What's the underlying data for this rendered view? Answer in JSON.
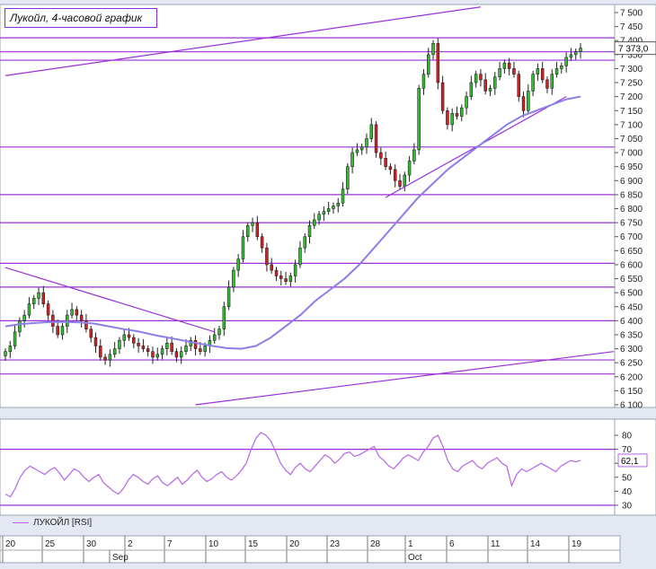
{
  "chart_data": [
    {
      "type": "candlestick",
      "title": "Лукойл, 4-часовой график",
      "y_axis": {
        "min": 6100,
        "max": 7500,
        "step": 50,
        "ticks": [
          "6 100",
          "6 150",
          "6 200",
          "6 250",
          "6 300",
          "6 350",
          "6 400",
          "6 450",
          "6 500",
          "6 550",
          "6 600",
          "6 650",
          "6 700",
          "6 750",
          "6 800",
          "6 850",
          "6 900",
          "6 950",
          "7 000",
          "7 050",
          "7 100",
          "7 150",
          "7 200",
          "7 250",
          "7 300",
          "7 350",
          "7 400",
          "7 450",
          "7 500"
        ]
      },
      "last_price_label": "7 373,0",
      "last_price": 7373,
      "close_series": [
        6290,
        6310,
        6360,
        6400,
        6420,
        6460,
        6480,
        6500,
        6460,
        6420,
        6380,
        6350,
        6380,
        6420,
        6440,
        6420,
        6400,
        6370,
        6340,
        6310,
        6270,
        6260,
        6280,
        6300,
        6330,
        6350,
        6340,
        6320,
        6310,
        6300,
        6290,
        6270,
        6280,
        6300,
        6320,
        6290,
        6270,
        6290,
        6310,
        6330,
        6300,
        6290,
        6310,
        6330,
        6350,
        6370,
        6450,
        6520,
        6580,
        6620,
        6700,
        6740,
        6750,
        6700,
        6660,
        6600,
        6580,
        6560,
        6550,
        6540,
        6560,
        6600,
        6660,
        6700,
        6740,
        6760,
        6780,
        6790,
        6800,
        6810,
        6820,
        6870,
        6950,
        7000,
        7010,
        7020,
        7050,
        7100,
        7000,
        6980,
        6950,
        6940,
        6900,
        6880,
        6920,
        6970,
        7010,
        7230,
        7280,
        7350,
        7390,
        7250,
        7150,
        7100,
        7140,
        7130,
        7160,
        7200,
        7250,
        7280,
        7260,
        7220,
        7230,
        7270,
        7300,
        7320,
        7300,
        7280,
        7200,
        7150,
        7220,
        7280,
        7300,
        7260,
        7230,
        7280,
        7300,
        7310,
        7340,
        7350,
        7360,
        7373
      ],
      "moving_average": [
        6380,
        6388,
        6392,
        6395,
        6396,
        6394,
        6390,
        6380,
        6370,
        6362,
        6350,
        6340,
        6330,
        6320,
        6310,
        6302,
        6300,
        6310,
        6340,
        6380,
        6420,
        6470,
        6510,
        6550,
        6600,
        6660,
        6720,
        6780,
        6840,
        6890,
        6940,
        6980,
        7020,
        7060,
        7100,
        7130,
        7150,
        7170,
        7190,
        7200
      ],
      "horizontal_levels": [
        7410,
        7330,
        7360,
        7020,
        6850,
        6750,
        6605,
        6520,
        6400,
        6260,
        6210
      ],
      "trend_lines": [
        {
          "from": [
            0,
            7275
          ],
          "to": [
            100,
            7520
          ]
        },
        {
          "from": [
            0,
            6590
          ],
          "to": [
            44,
            6360
          ]
        },
        {
          "from": [
            40,
            6100
          ],
          "to": [
            128,
            6290
          ]
        },
        {
          "from": [
            80,
            6840
          ],
          "to": [
            118,
            7200
          ]
        }
      ]
    },
    {
      "type": "line",
      "legend": "ЛУКОЙЛ [RSI]",
      "y_axis": {
        "min": 25,
        "max": 90,
        "ticks": [
          "30",
          "40",
          "50",
          "60",
          "70",
          "80"
        ]
      },
      "levels": [
        30,
        70
      ],
      "last_value_label": "62,1",
      "values": [
        38,
        36,
        42,
        50,
        55,
        58,
        56,
        54,
        52,
        55,
        57,
        53,
        48,
        52,
        56,
        54,
        50,
        47,
        50,
        52,
        46,
        43,
        40,
        38,
        42,
        48,
        52,
        50,
        47,
        45,
        49,
        51,
        46,
        44,
        47,
        50,
        45,
        48,
        52,
        55,
        50,
        47,
        49,
        52,
        54,
        50,
        48,
        51,
        55,
        60,
        70,
        78,
        82,
        80,
        76,
        68,
        60,
        55,
        52,
        57,
        60,
        56,
        54,
        58,
        62,
        66,
        64,
        60,
        63,
        67,
        68,
        65,
        66,
        68,
        70,
        72,
        65,
        62,
        58,
        56,
        60,
        64,
        66,
        64,
        62,
        68,
        72,
        78,
        80,
        72,
        62,
        56,
        54,
        58,
        60,
        62,
        58,
        56,
        60,
        62,
        64,
        60,
        58,
        44,
        52,
        56,
        54,
        56,
        58,
        60,
        58,
        56,
        54,
        58,
        60,
        62,
        61,
        62.1
      ]
    }
  ],
  "x_axis": {
    "day_labels": [
      "20",
      "25",
      "30",
      "2",
      "7",
      "10",
      "15",
      "20",
      "23",
      "28",
      "1",
      "6",
      "11",
      "14",
      "19"
    ],
    "month_labels": [
      "Sep",
      "Oct"
    ]
  }
}
